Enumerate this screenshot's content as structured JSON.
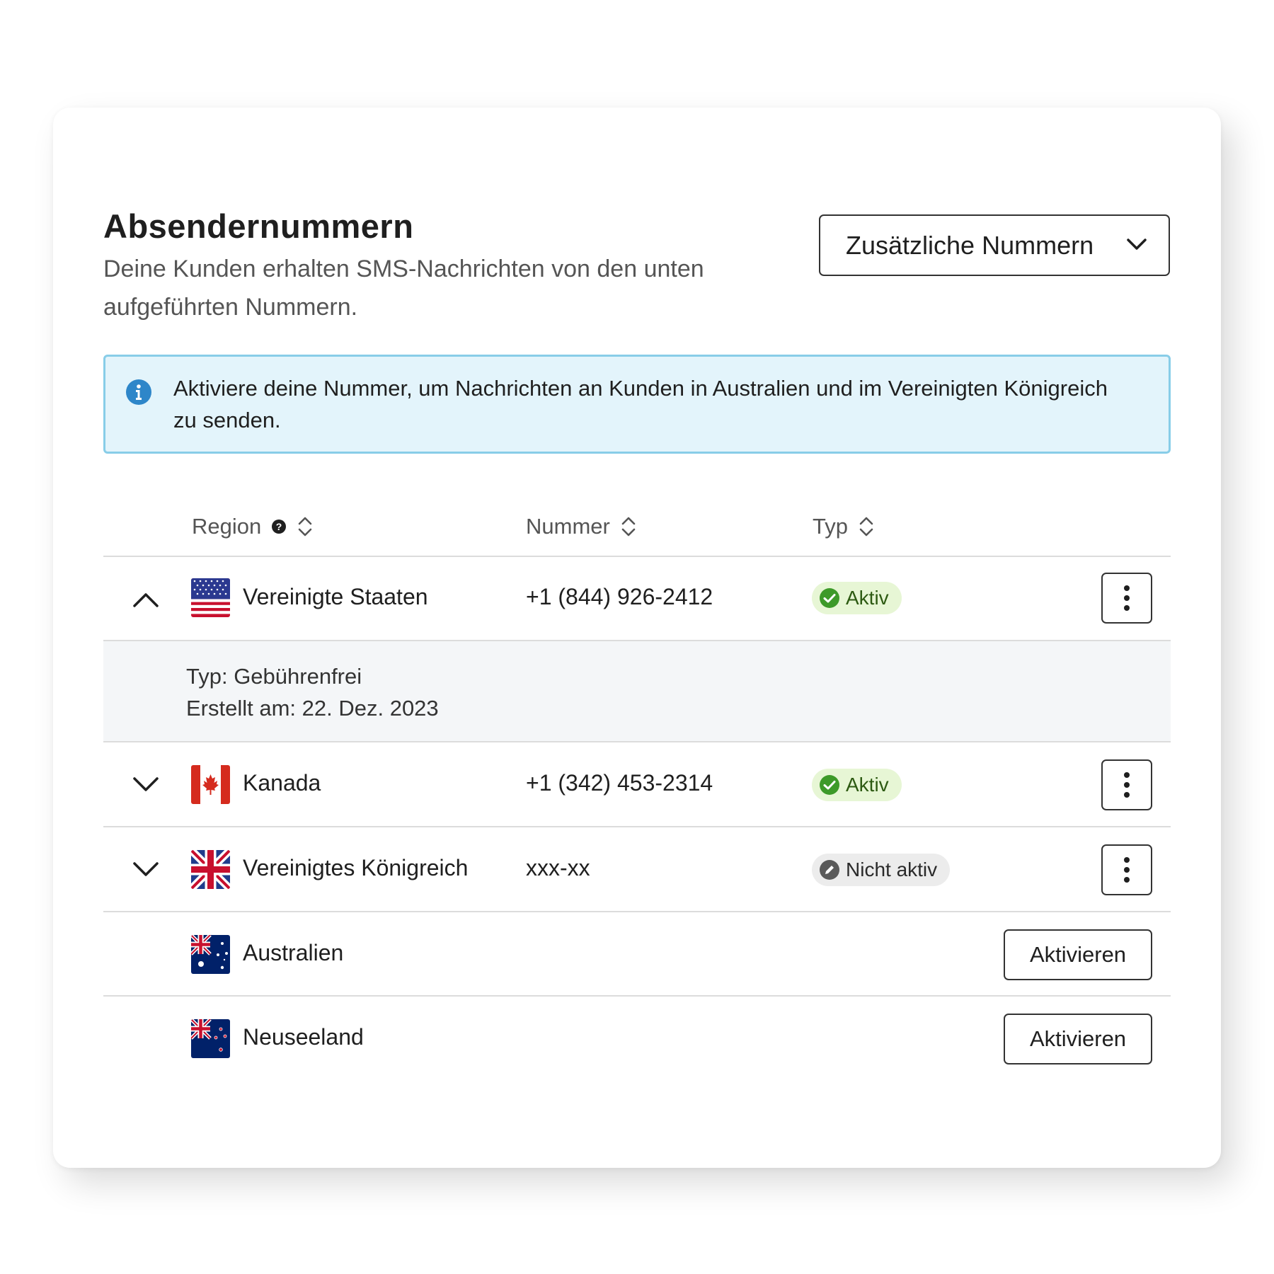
{
  "header": {
    "title": "Absendernummern",
    "subtitle": "Deine Kunden erhalten SMS-Nachrichten von den unten aufgeführten Nummern.",
    "dropdown_label": "Zusätzliche Nummern"
  },
  "banner": {
    "message": "Aktiviere deine Nummer, um Nachrichten an Kunden in Australien und im Vereinigten Königreich zu senden.",
    "icon": "info-icon",
    "colors": {
      "background": "#e3f4fb",
      "border": "#88cde8",
      "icon": "#2e86c9"
    }
  },
  "table": {
    "columns": {
      "region": "Region",
      "number": "Nummer",
      "type": "Typ"
    },
    "rows": [
      {
        "country": "Vereinigte Staaten",
        "number": "+1 (844) 926-2412",
        "status": "Aktiv",
        "flag": "us-flag",
        "toggle": "chevron-up-icon",
        "expanded": true
      },
      {
        "country": "Kanada",
        "number": "+1 (342) 453-2314",
        "status": "Aktiv",
        "flag": "ca-flag",
        "toggle": "chevron-down-icon",
        "expanded": false
      },
      {
        "country": "Vereinigtes Königreich",
        "number": "xxx-xx",
        "status": "Nicht aktiv",
        "flag": "uk-flag",
        "toggle": "chevron-down-icon",
        "expanded": false
      },
      {
        "country": "Australien",
        "action": "Aktivieren",
        "flag": "au-flag"
      },
      {
        "country": "Neuseeland",
        "action": "Aktivieren",
        "flag": "nz-flag"
      }
    ],
    "details": {
      "type_line": "Typ: Gebührenfrei",
      "created_line": "Erstellt am: 22. Dez. 2023"
    }
  },
  "colors": {
    "active_badge": "#e7f6d5",
    "active_check": "#3d9a29",
    "inactive_badge": "#ececec"
  }
}
